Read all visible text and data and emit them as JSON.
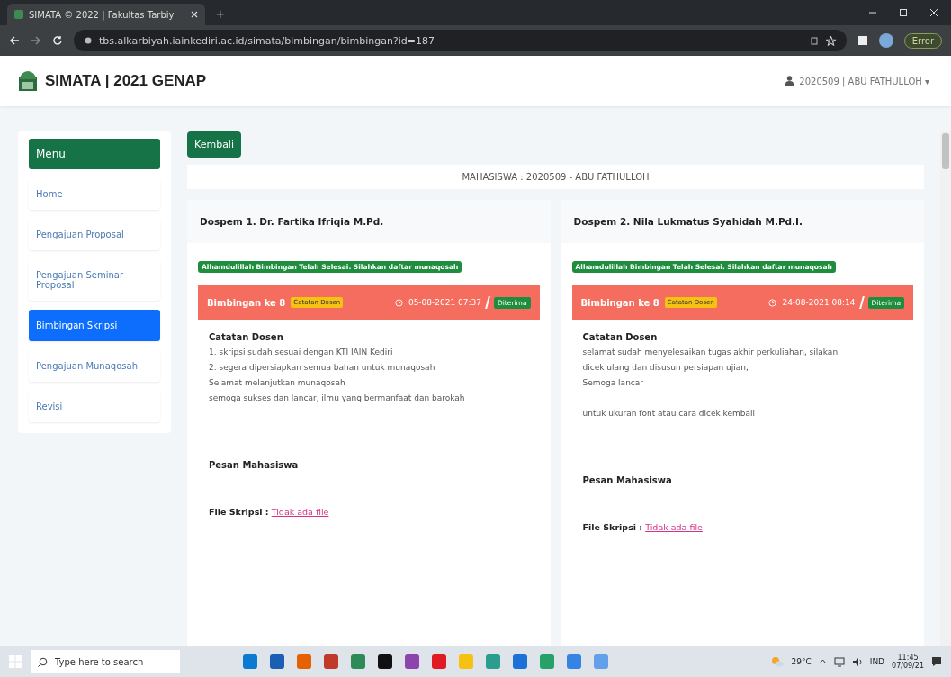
{
  "browser": {
    "tab_title": "SIMATA © 2022 | Fakultas Tarbiy",
    "new_tab": "+",
    "url": "tbs.alkarbiyah.iainkediri.ac.id/simata/bimbingan/bimbingan?id=187",
    "profile_button": "Error"
  },
  "header": {
    "brand": "SIMATA | 2021 GENAP",
    "user": "2020509 | ABU FATHULLOH ▾"
  },
  "sidebar": {
    "title": "Menu",
    "items": [
      {
        "label": "Home",
        "selected": false
      },
      {
        "label": "Pengajuan Proposal",
        "selected": false
      },
      {
        "label": "Pengajuan Seminar Proposal",
        "selected": false
      },
      {
        "label": "Bimbingan Skripsi",
        "selected": true
      },
      {
        "label": "Pengajuan Munaqosah",
        "selected": false
      },
      {
        "label": "Revisi",
        "selected": false
      }
    ]
  },
  "back_button": "Kembali",
  "student": "MAHASISWA : 2020509 - ABU FATHULLOH",
  "supervisors": [
    {
      "title": "Dospem 1. Dr. Fartika Ifriqia M.Pd.",
      "notice": "Alhamdulillah Bimbingan Telah Selesai. Silahkan daftar munaqosah",
      "session": "Bimbingan ke 8",
      "note_badge": "Catatan Dosen",
      "date": "05-08-2021 07:37",
      "status": "Diterima",
      "note_heading": "Catatan Dosen",
      "note_paragraphs": [
        [
          "1. skripsi sudah sesuai dengan KTI IAIN Kediri",
          "2. segera dipersiapkan semua bahan untuk munaqosah",
          "Selamat melanjutkan munaqosah",
          "semoga sukses dan lancar, ilmu yang bermanfaat dan barokah"
        ]
      ],
      "message_heading": "Pesan Mahasiswa",
      "file_label": "File Skripsi :",
      "file_link": "Tidak ada file"
    },
    {
      "title": "Dospem 2. Nila Lukmatus Syahidah M.Pd.I.",
      "notice": "Alhamdulillah Bimbingan Telah Selesai. Silahkan daftar munaqosah",
      "session": "Bimbingan ke 8",
      "note_badge": "Catatan Dosen",
      "date": "24-08-2021 08:14",
      "status": "Diterima",
      "note_heading": "Catatan Dosen",
      "note_paragraphs": [
        [
          "selamat sudah menyelesaikan tugas akhir perkuliahan, silakan",
          "dicek ulang dan disusun persiapan ujian,",
          "Semoga lancar"
        ],
        [
          "untuk ukuran font atau cara dicek kembali"
        ]
      ],
      "message_heading": "Pesan Mahasiswa",
      "file_label": "File Skripsi :",
      "file_link": "Tidak ada file"
    }
  ],
  "taskbar": {
    "search_placeholder": "Type here to search",
    "weather": "29°C",
    "language": "IND",
    "time": "11:45",
    "date": "07/09/21"
  }
}
